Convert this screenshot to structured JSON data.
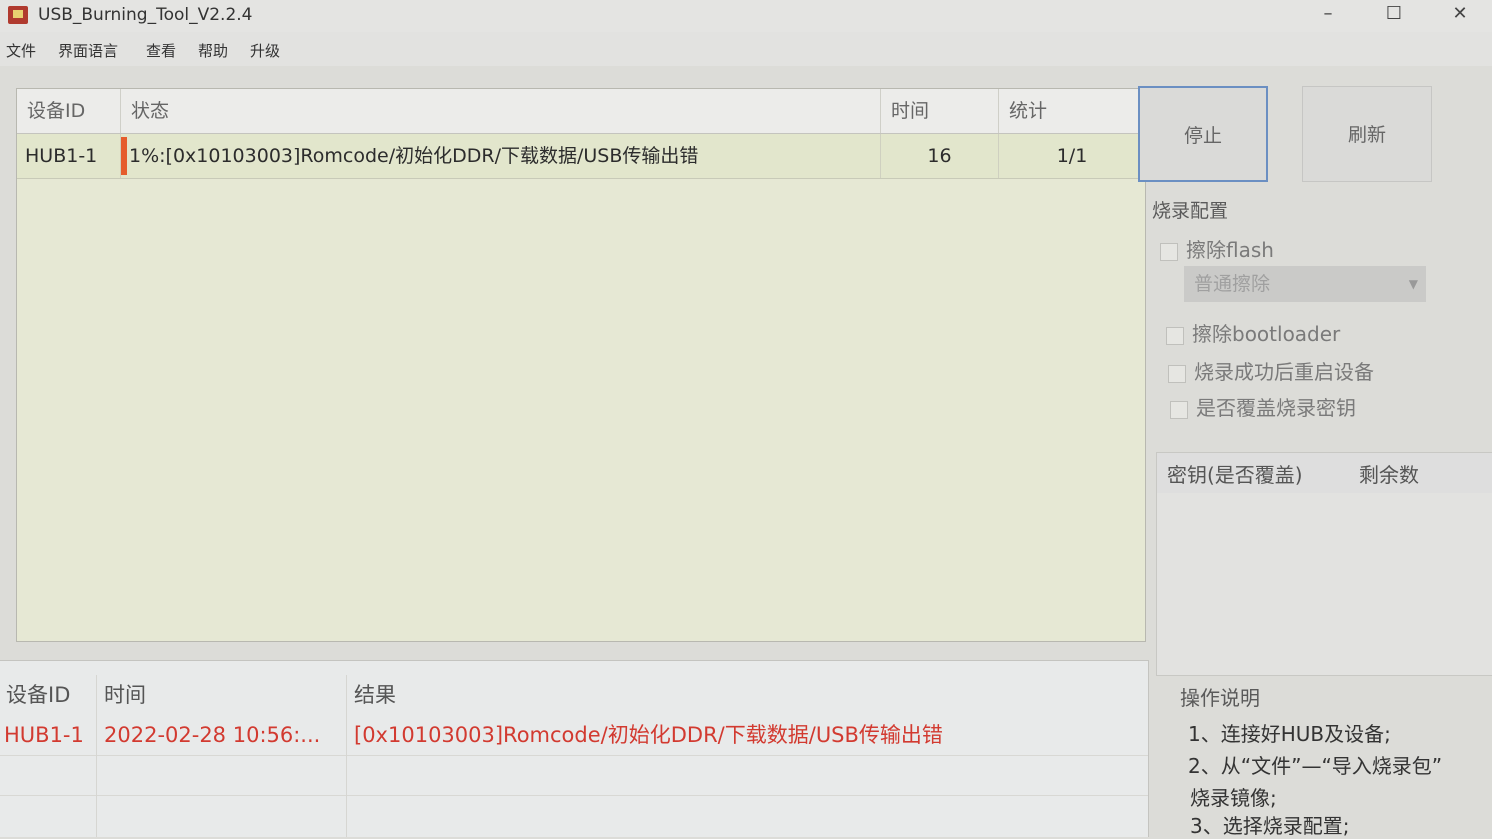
{
  "window": {
    "title": "USB_Burning_Tool_V2.2.4",
    "minimize_glyph": "–",
    "maximize_glyph": "☐",
    "close_glyph": "✕"
  },
  "menu": {
    "items": [
      "文件",
      "界面语言",
      "查看",
      "帮助",
      "升级"
    ]
  },
  "device_table": {
    "headers": [
      "设备ID",
      "状态",
      "时间",
      "统计"
    ],
    "rows": [
      {
        "id": "HUB1-1",
        "status": "1%:[0x10103003]Romcode/初始化DDR/下载数据/USB传输出错",
        "time": "16",
        "count": "1/1",
        "progress": 0.01
      }
    ]
  },
  "buttons": {
    "stop": "停止",
    "refresh": "刷新"
  },
  "burn_config": {
    "title": "烧录配置",
    "erase_flash": "擦除flash",
    "erase_mode": "普通擦除",
    "erase_bootloader": "擦除bootloader",
    "reboot_after": "烧录成功后重启设备",
    "overwrite_key": "是否覆盖烧录密钥"
  },
  "key_table": {
    "headers": [
      "密钥(是否覆盖)",
      "剩余数"
    ]
  },
  "log": {
    "headers": [
      "设备ID",
      "时间",
      "结果"
    ],
    "rows": [
      {
        "id": "HUB1-1",
        "time": "2022-02-28 10:56:...",
        "result": "[0x10103003]Romcode/初始化DDR/下载数据/USB传输出错"
      }
    ]
  },
  "help": {
    "title": "操作说明",
    "lines": [
      "1、连接好HUB及设备;",
      "2、从“文件”—“导入烧录包”",
      "烧录镜像;",
      "3、选择烧录配置;"
    ]
  },
  "colors": {
    "accent": "#6b8fc2",
    "error": "#d23a30",
    "progress": "#e55c2c"
  }
}
